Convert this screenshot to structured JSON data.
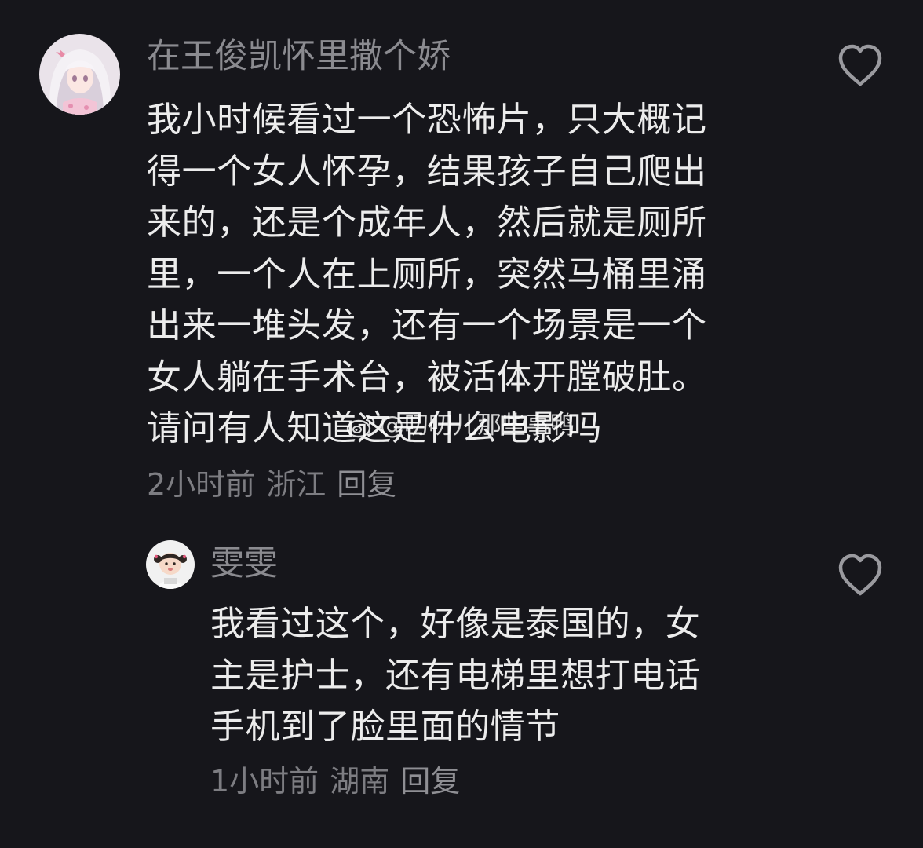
{
  "comments": [
    {
      "username": "在王俊凯怀里撒个娇",
      "lines": [
        "我小时候看过一个恐怖片，只大概记",
        "得一个女人怀孕，结果孩子自己爬出",
        "来的，还是个成年人，然后就是厕所",
        "里，一个人在上厕所，突然马桶里涌",
        "出来一堆头发，还有一个场景是一个",
        "女人躺在手术台，被活体开膛破肚。",
        "请问有人知道这是什么电影吗"
      ],
      "time": "2小时前",
      "location": "浙江",
      "reply_label": "回复",
      "like_icon": "heart-outline-icon"
    },
    {
      "username": "雯雯",
      "lines": [
        "我看过这个，好像是泰国的，女",
        "主是护士，还有电梯里想打电话",
        "手机到了脸里面的情节"
      ],
      "time": "1小时前",
      "location": "湖南",
      "reply_label": "回复",
      "like_icon": "heart-outline-icon"
    }
  ],
  "watermark": {
    "text": "@叨叨儿那些事鸭",
    "icon": "weibo-logo-icon"
  },
  "colors": {
    "background": "#16161b",
    "text": "#ececec",
    "secondary": "#8b8b90"
  }
}
